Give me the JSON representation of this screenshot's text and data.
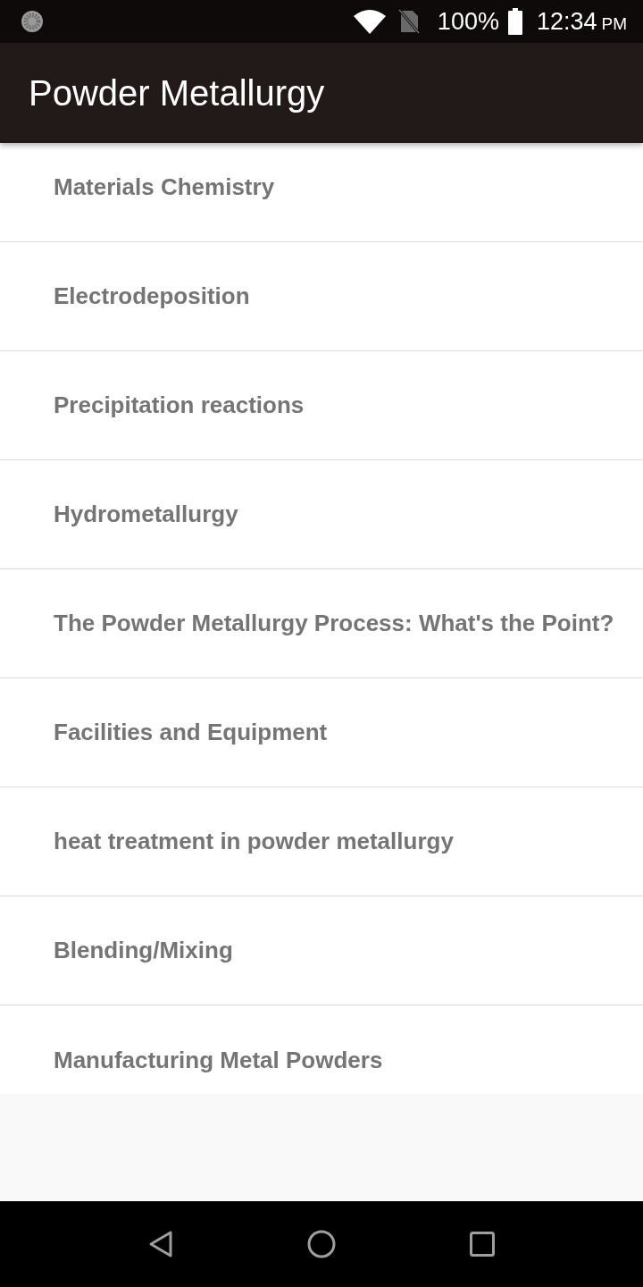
{
  "status_bar": {
    "battery": "100%",
    "time": "12:34",
    "period": "PM"
  },
  "app_bar": {
    "title": "Powder Metallurgy"
  },
  "topics": [
    {
      "title": "Materials Chemistry"
    },
    {
      "title": "Electrodeposition"
    },
    {
      "title": "Precipitation reactions"
    },
    {
      "title": "Hydrometallurgy"
    },
    {
      "title": "The Powder Metallurgy Process: What's the Point?"
    },
    {
      "title": "Facilities and Equipment"
    },
    {
      "title": "heat treatment in powder metallurgy"
    },
    {
      "title": "Blending/Mixing"
    },
    {
      "title": "Manufacturing Metal Powders"
    }
  ]
}
